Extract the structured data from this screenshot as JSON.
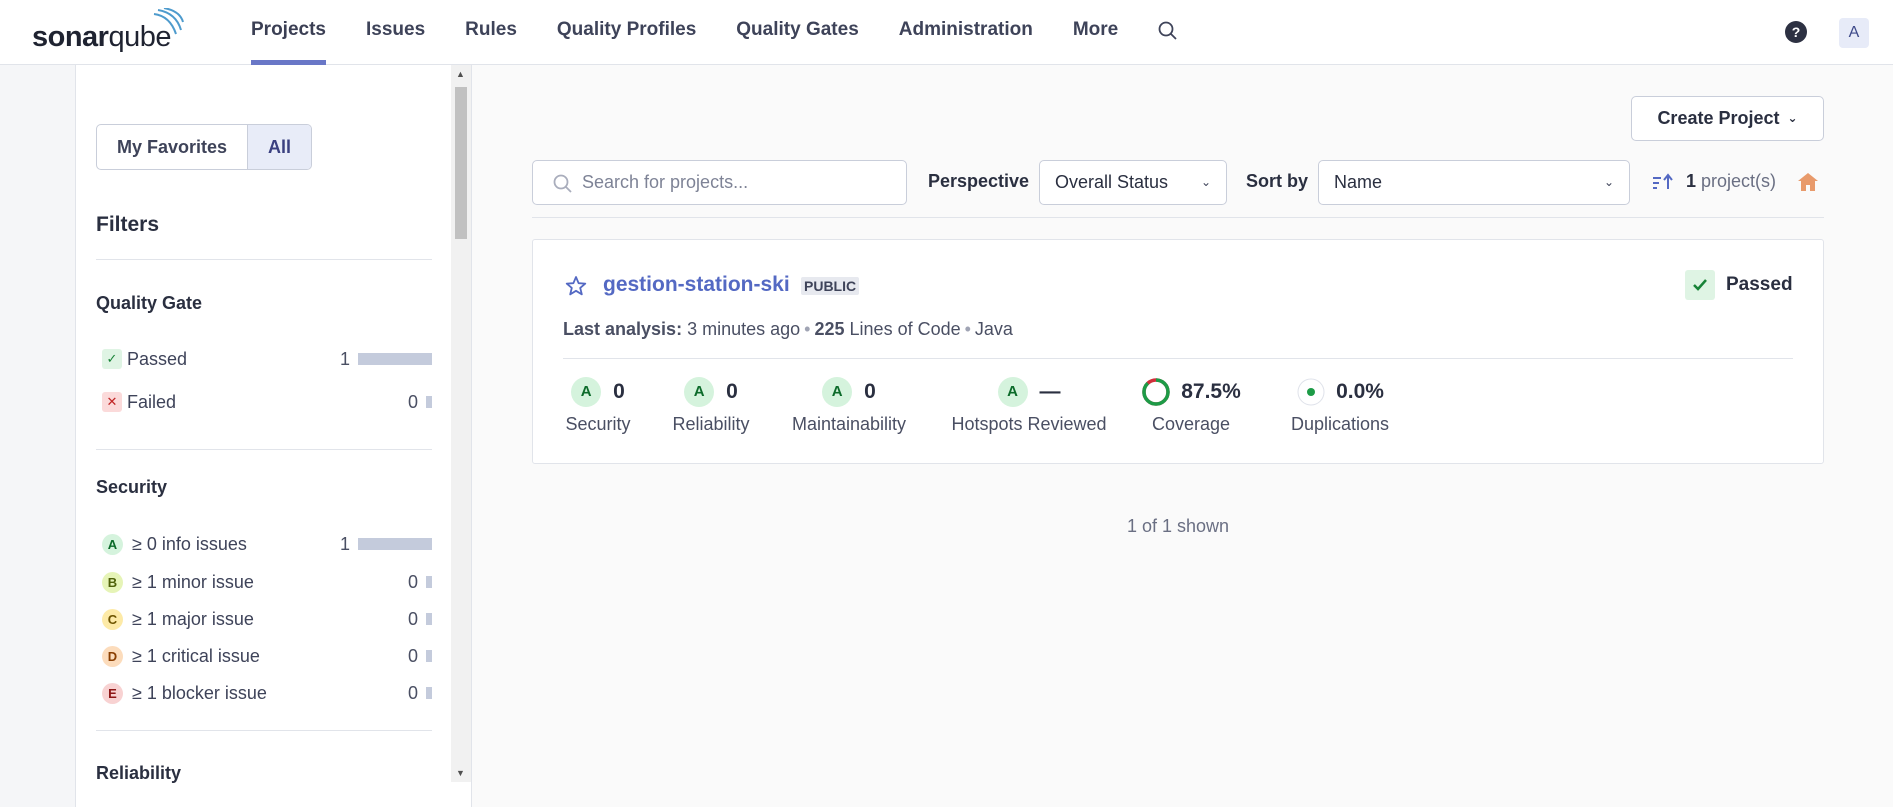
{
  "brand": {
    "logo_text_a": "sonar",
    "logo_text_b": "qube"
  },
  "nav": {
    "items": [
      "Projects",
      "Issues",
      "Rules",
      "Quality Profiles",
      "Quality Gates",
      "Administration",
      "More"
    ],
    "active": "Projects",
    "help": "?",
    "avatar": "A"
  },
  "sidebar": {
    "toggle": {
      "favorites": "My Favorites",
      "all": "All",
      "selected": "All"
    },
    "filters_title": "Filters",
    "quality_gate": {
      "title": "Quality Gate",
      "rows": [
        {
          "label": "Passed",
          "count": "1",
          "icon": "check-icon",
          "fraction": 1.0
        },
        {
          "label": "Failed",
          "count": "0",
          "icon": "cross-icon",
          "fraction": 0.0
        }
      ]
    },
    "security": {
      "title": "Security",
      "rows": [
        {
          "rating": "A",
          "label": "≥ 0 info issues",
          "count": "1",
          "fraction": 1.0
        },
        {
          "rating": "B",
          "label": "≥ 1 minor issue",
          "count": "0",
          "fraction": 0.0
        },
        {
          "rating": "C",
          "label": "≥ 1 major issue",
          "count": "0",
          "fraction": 0.0
        },
        {
          "rating": "D",
          "label": "≥ 1 critical issue",
          "count": "0",
          "fraction": 0.0
        },
        {
          "rating": "E",
          "label": "≥ 1 blocker issue",
          "count": "0",
          "fraction": 0.0
        }
      ]
    },
    "reliability": {
      "title": "Reliability"
    }
  },
  "toolbar": {
    "create_project": "Create Project",
    "search_placeholder": "Search for projects...",
    "perspective_label": "Perspective",
    "perspective_value": "Overall Status",
    "sort_label": "Sort by",
    "sort_value": "Name",
    "project_count": "1",
    "project_count_suffix": "project(s)"
  },
  "project": {
    "name": "gestion-station-ski",
    "visibility": "PUBLIC",
    "quality_gate": "Passed",
    "last_analysis_label": "Last analysis:",
    "last_analysis_value": "3 minutes ago",
    "loc_value": "225",
    "loc_label": "Lines of Code",
    "language": "Java",
    "metrics": [
      {
        "rating": "A",
        "value": "0",
        "label": "Security"
      },
      {
        "rating": "A",
        "value": "0",
        "label": "Reliability"
      },
      {
        "rating": "A",
        "value": "0",
        "label": "Maintainability"
      },
      {
        "rating": "A",
        "value": "—",
        "label": "Hotspots Reviewed"
      }
    ],
    "coverage": {
      "value": "87.5%",
      "label": "Coverage",
      "percent": 87.5
    },
    "duplications": {
      "value": "0.0%",
      "label": "Duplications",
      "percent": 0.0
    }
  },
  "footer": {
    "shown": "1 of 1 shown"
  },
  "colors": {
    "accent": "#6977c7",
    "link": "#5469c3",
    "pass": "#198338",
    "fail": "#c02525",
    "coverage_good": "#1d9b47",
    "coverage_bad": "#d02f3a"
  }
}
